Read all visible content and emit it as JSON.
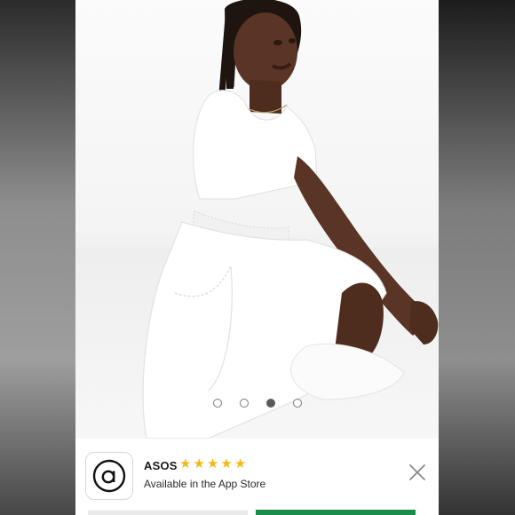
{
  "carousel": {
    "slides": 4,
    "active_index": 2
  },
  "banner": {
    "app_name": "ASOS",
    "rating_stars": 5,
    "subtitle": "Available in the App Store",
    "icon": "asos-a-logo-icon",
    "close_icon": "close-icon"
  },
  "colors": {
    "star": "#f3b818",
    "cta_green": "#1a8d4a"
  }
}
